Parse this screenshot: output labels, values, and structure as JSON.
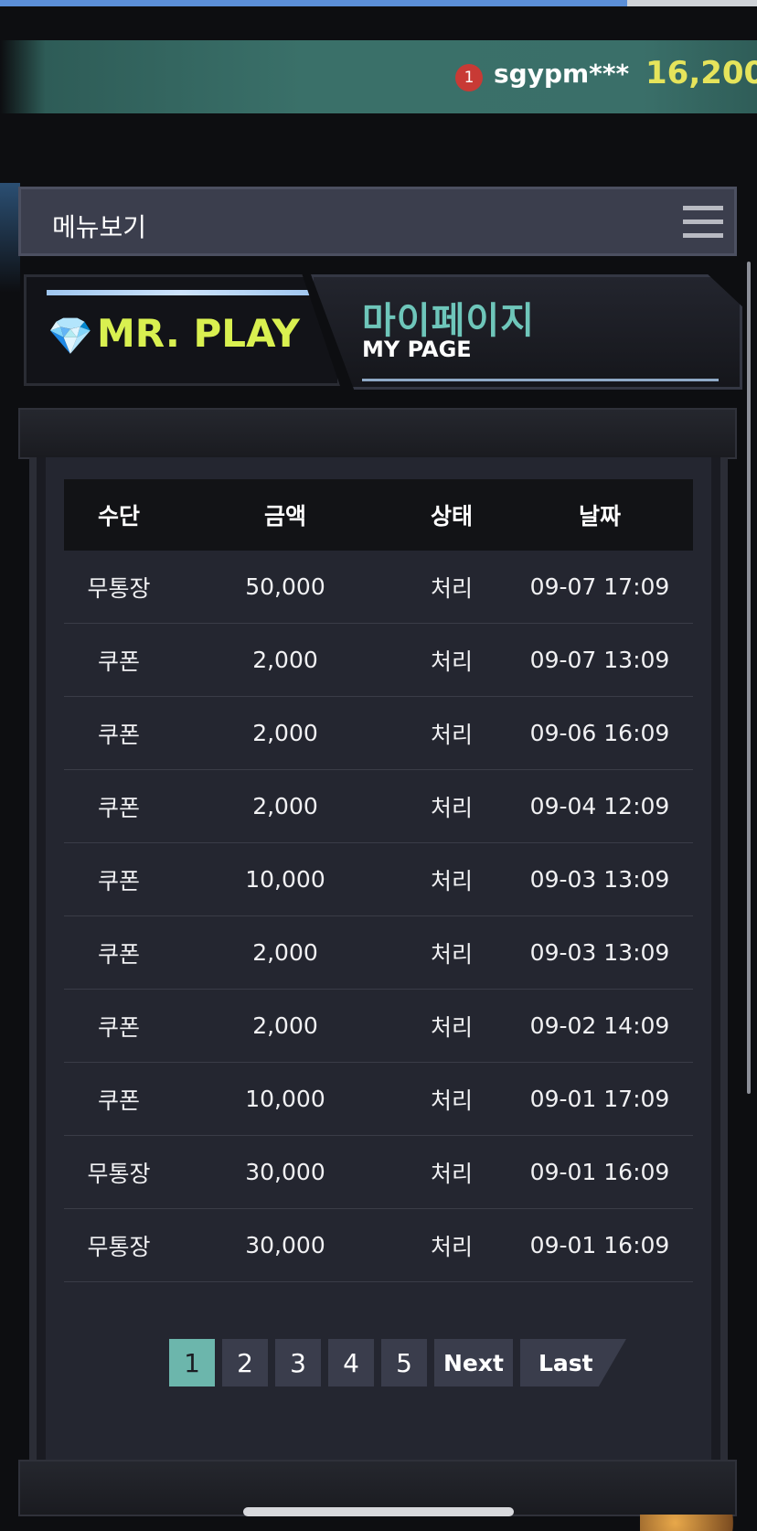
{
  "userbar": {
    "notification_count": "1",
    "username": "sgypm***",
    "balance": "16,200"
  },
  "menubar": {
    "label": "메뉴보기"
  },
  "banner": {
    "logo_text": "MR. PLAY",
    "title_ko": "마이페이지",
    "title_en": "MY PAGE"
  },
  "table": {
    "headers": [
      "수단",
      "금액",
      "상태",
      "날짜"
    ],
    "rows": [
      {
        "method": "무통장",
        "amount": "50,000",
        "status": "처리",
        "date": "09-07 17:09"
      },
      {
        "method": "쿠폰",
        "amount": "2,000",
        "status": "처리",
        "date": "09-07 13:09"
      },
      {
        "method": "쿠폰",
        "amount": "2,000",
        "status": "처리",
        "date": "09-06 16:09"
      },
      {
        "method": "쿠폰",
        "amount": "2,000",
        "status": "처리",
        "date": "09-04 12:09"
      },
      {
        "method": "쿠폰",
        "amount": "10,000",
        "status": "처리",
        "date": "09-03 13:09"
      },
      {
        "method": "쿠폰",
        "amount": "2,000",
        "status": "처리",
        "date": "09-03 13:09"
      },
      {
        "method": "쿠폰",
        "amount": "2,000",
        "status": "처리",
        "date": "09-02 14:09"
      },
      {
        "method": "쿠폰",
        "amount": "10,000",
        "status": "처리",
        "date": "09-01 17:09"
      },
      {
        "method": "무통장",
        "amount": "30,000",
        "status": "처리",
        "date": "09-01 16:09"
      },
      {
        "method": "무통장",
        "amount": "30,000",
        "status": "처리",
        "date": "09-01 16:09"
      }
    ]
  },
  "pagination": {
    "pages": [
      "1",
      "2",
      "3",
      "4",
      "5"
    ],
    "active_page": "1",
    "next_label": "Next",
    "last_label": "Last"
  },
  "colors": {
    "accent_teal": "#6cb6ac",
    "logo_yellow": "#d9f050",
    "balance_yellow": "#e6e45b",
    "badge_red": "#c83a35"
  },
  "icons": {
    "menu": "hamburger-icon",
    "logo": "diamond-icon"
  }
}
